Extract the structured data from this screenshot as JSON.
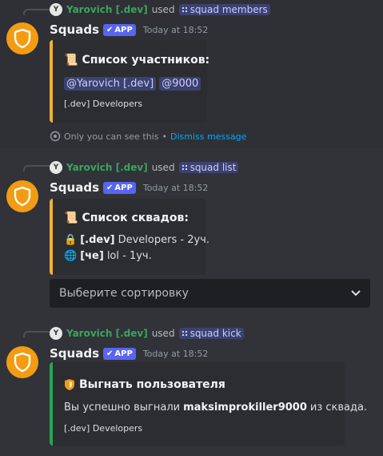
{
  "bot": {
    "name": "Squads",
    "badge": "APP",
    "avatar_icon": "shield-icon",
    "avatar_color": "#f39c12"
  },
  "messages": [
    {
      "reply": {
        "user": "Yarovich [.dev]",
        "used": "used",
        "command": "squad members"
      },
      "timestamp": "Today at 18:52",
      "embed": {
        "title": "Список участников:",
        "mentions": [
          "@Yarovich [.dev]",
          "@9000"
        ],
        "footer": "[.dev] Developers"
      },
      "ephemeral": {
        "text": "Only you can see this",
        "sep": "•",
        "link": "Dismiss message"
      }
    },
    {
      "reply": {
        "user": "Yarovich [.dev]",
        "used": "used",
        "command": "squad list"
      },
      "timestamp": "Today at 18:52",
      "embed": {
        "title": "Список сквадов:",
        "rows": [
          {
            "icon": "lock-icon",
            "tag": "[.dev]",
            "text": "Developers - 2уч."
          },
          {
            "icon": "globe-icon",
            "tag": "[че]",
            "text": "lol - 1уч."
          }
        ]
      },
      "select": {
        "placeholder": "Выберите сортировку"
      }
    },
    {
      "reply": {
        "user": "Yarovich [.dev]",
        "used": "used",
        "command": "squad kick"
      },
      "timestamp": "Today at 18:52",
      "embed": {
        "title": "Выгнать пользователя",
        "body_pre": "Вы успешно выгнали",
        "body_user": "maksimprokiller9000",
        "body_post": "из сквада.",
        "footer": "[.dev] Developers",
        "accent": "#23a55a"
      }
    }
  ],
  "colors": {
    "background": "#313338",
    "embed_bg": "#2b2d31",
    "accent_yellow": "#f0b132",
    "accent_green": "#23a55a",
    "link": "#00a8fc"
  }
}
